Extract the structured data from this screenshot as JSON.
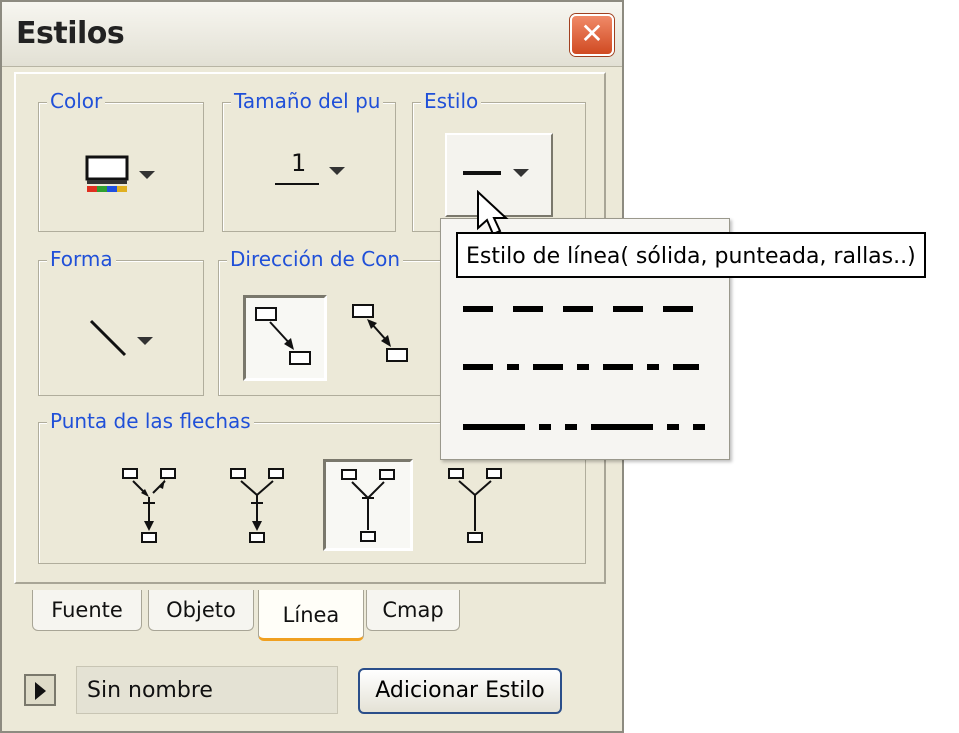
{
  "window": {
    "title": "Estilos",
    "close_icon": "close-icon"
  },
  "groups": {
    "color": {
      "label": "Color"
    },
    "point_size": {
      "label": "Tamaño del pu",
      "value": "1"
    },
    "style": {
      "label": "Estilo"
    },
    "shape": {
      "label": "Forma"
    },
    "direction": {
      "label": "Dirección de Con"
    },
    "arrowheads": {
      "label": "Punta de las flechas"
    }
  },
  "tooltip": {
    "text": "Estilo de línea( sólida, punteada, rallas..)"
  },
  "line_style_options": [
    "dashed",
    "dash-dot",
    "long-dash-dot-dot"
  ],
  "tabs": [
    {
      "label": "Fuente",
      "active": false
    },
    {
      "label": "Objeto",
      "active": false
    },
    {
      "label": "Línea",
      "active": true
    },
    {
      "label": "Cmap",
      "active": false
    }
  ],
  "footer": {
    "style_name": "Sin nombre",
    "add_style_label": "Adicionar Estilo"
  },
  "colors": {
    "legend_text": "#2050d8",
    "window_bg": "#ece9d8",
    "close_button": "#d04a22",
    "active_tab_underline": "#f0a020"
  }
}
